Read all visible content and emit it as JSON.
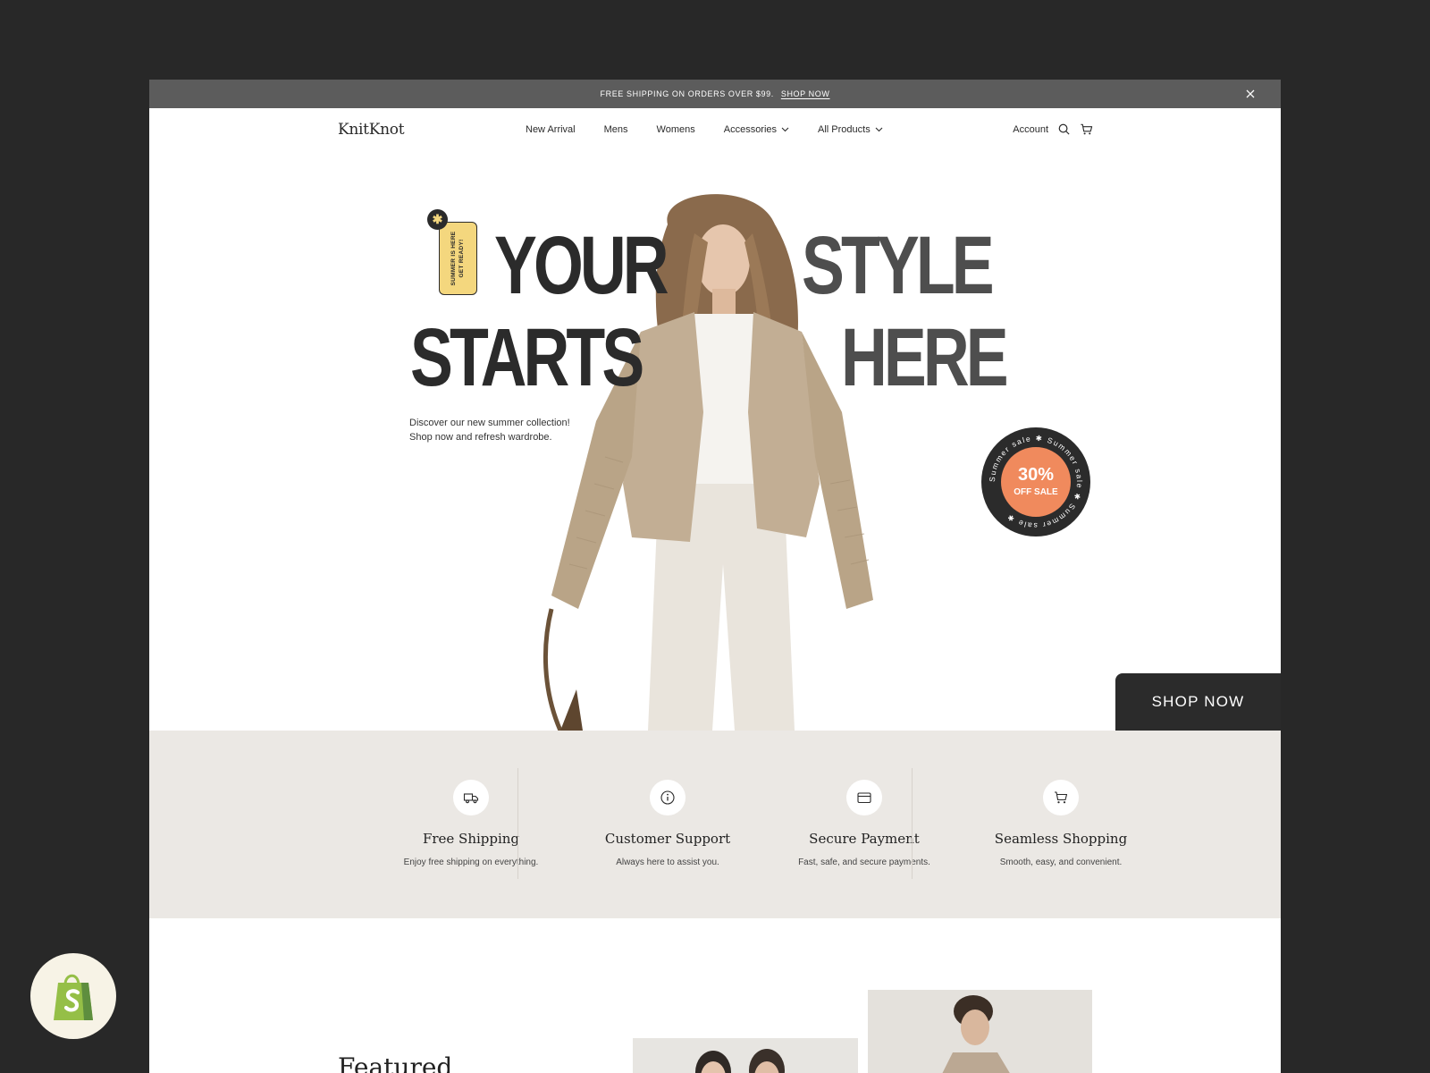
{
  "announcement": {
    "text": "FREE SHIPPING ON ORDERS OVER $99.",
    "link": "SHOP NOW",
    "close_icon": "close-icon"
  },
  "header": {
    "logo": "KnitKnot",
    "nav": [
      {
        "label": "New Arrival",
        "dropdown": false
      },
      {
        "label": "Mens",
        "dropdown": false
      },
      {
        "label": "Womens",
        "dropdown": false
      },
      {
        "label": "Accessories",
        "dropdown": true
      },
      {
        "label": "All Products",
        "dropdown": true
      }
    ],
    "account": "Account",
    "icons": [
      "search-icon",
      "cart-icon"
    ]
  },
  "hero": {
    "word1": "YOUR",
    "word2": "STYLE",
    "word3": "STARTS",
    "word4": "HERE",
    "tag_line1": "SUMMER IS HERE",
    "tag_line2": "GET READY!",
    "subtitle_line1": "Discover our new summer collection!",
    "subtitle_line2": "Shop now and refresh wardrobe.",
    "badge_percent": "30%",
    "badge_label": "OFF SALE",
    "badge_ring_text": "Summer sale ✱ Summer sale ✱ Summer sale ✱",
    "cta": "SHOP NOW"
  },
  "features": [
    {
      "icon": "truck-icon",
      "title": "Free Shipping",
      "desc": "Enjoy free shipping on everything."
    },
    {
      "icon": "info-icon",
      "title": "Customer Support",
      "desc": "Always here to assist you."
    },
    {
      "icon": "wallet-icon",
      "title": "Secure Payment",
      "desc": "Fast, safe, and secure payments."
    },
    {
      "icon": "cart-icon",
      "title": "Seamless Shopping",
      "desc": "Smooth, easy, and convenient."
    }
  ],
  "featured": {
    "title": "Featured"
  },
  "colors": {
    "background": "#282828",
    "announcement": "#5c5c5c",
    "headline_dark": "#2b2b2b",
    "headline_grey": "#4e4e4e",
    "tag_yellow": "#f4d77e",
    "badge_orange": "#f08a5d",
    "features_bg": "#ebe8e4",
    "shopify_green": "#95bf47"
  }
}
